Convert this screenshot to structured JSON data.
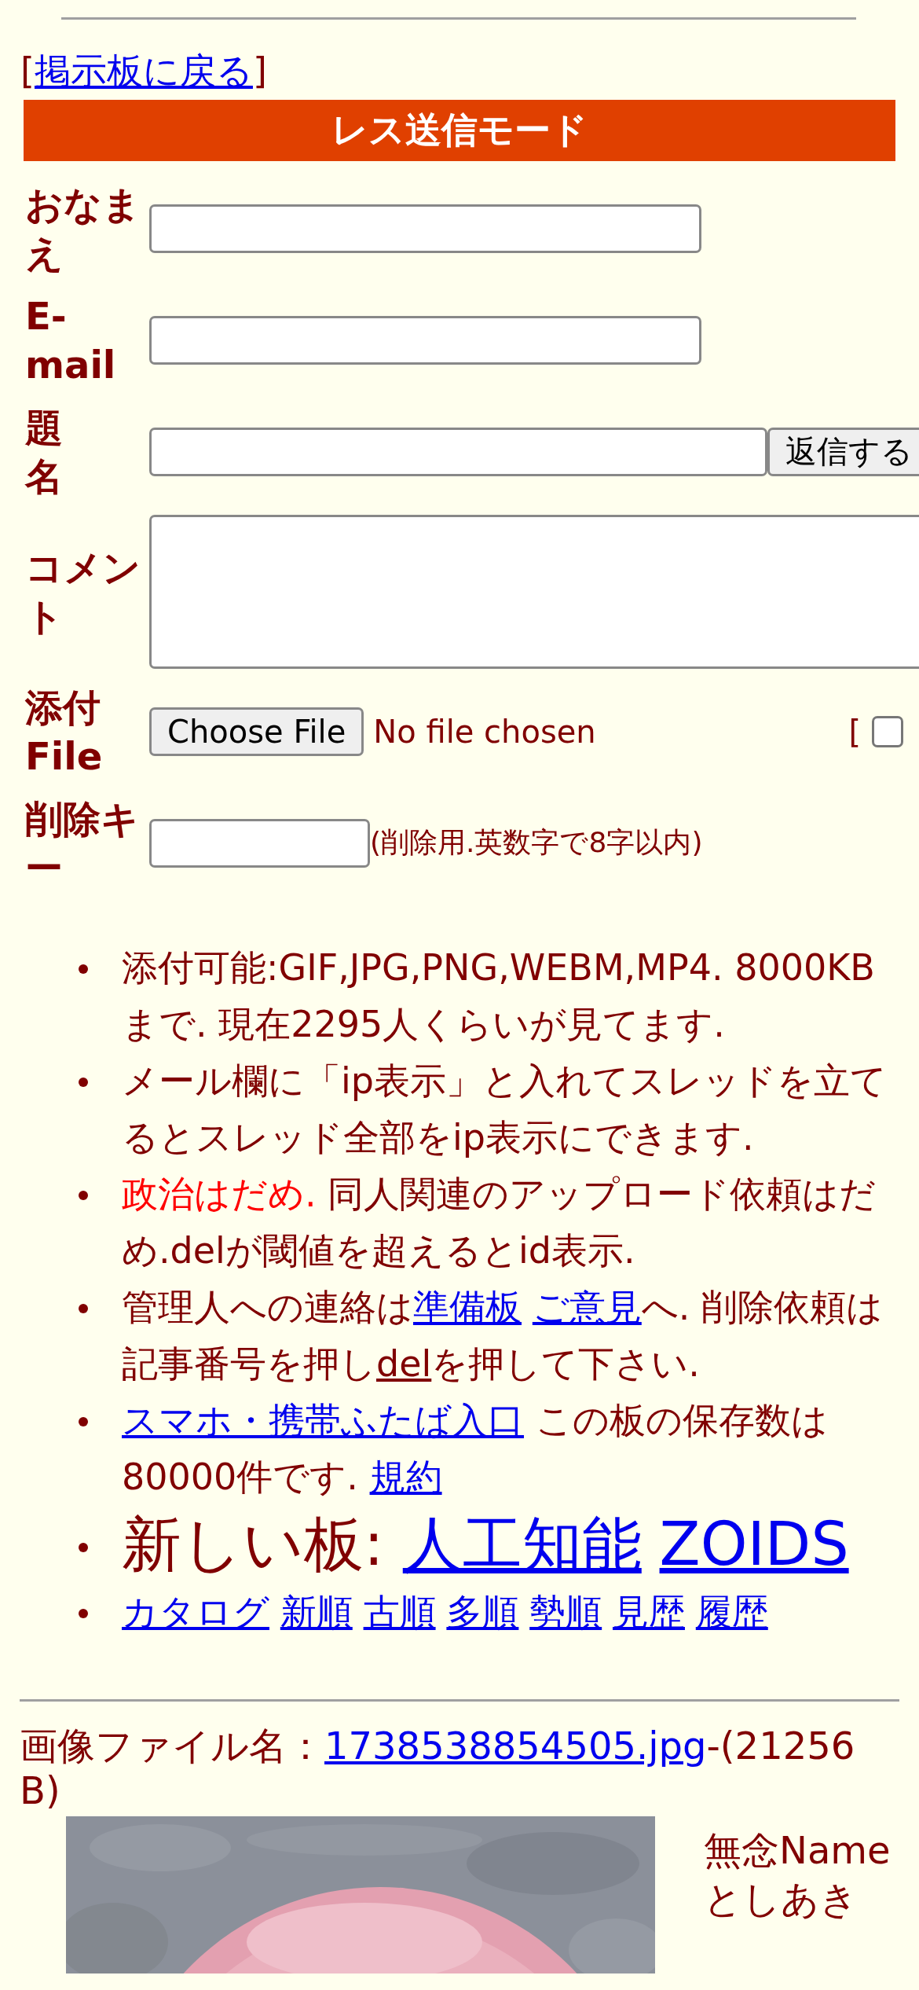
{
  "back_link": {
    "open": "[",
    "label": "掲示板に戻る",
    "close": "]"
  },
  "form": {
    "title": "レス送信モード",
    "rows": [
      {
        "kind": "text",
        "label": "おなまえ"
      },
      {
        "kind": "text",
        "label": "E-mail"
      },
      {
        "kind": "text_button",
        "label": "題名",
        "button": "返信する"
      },
      {
        "kind": "textarea",
        "label": "コメント"
      },
      {
        "kind": "file",
        "label": "添付File",
        "button": "Choose File",
        "status": "No file chosen",
        "bracket": "[",
        "checked": false
      },
      {
        "kind": "key",
        "label": "削除キー",
        "note": "(削除用.英数字で8字以内)"
      }
    ]
  },
  "notices": [
    {
      "kind": "normal",
      "parts": [
        {
          "kind": "text",
          "text": "添付可能:GIF,JPG,PNG,WEBM,MP4. 8000KBまで. 現在2295人くらいが見てます."
        }
      ]
    },
    {
      "kind": "normal",
      "parts": [
        {
          "kind": "text",
          "text": "メール欄に「ip表示」と入れてスレッドを立てるとスレッド全部をip表示にできます."
        }
      ]
    },
    {
      "kind": "normal",
      "parts": [
        {
          "kind": "warning",
          "text": "政治はだめ."
        },
        {
          "kind": "text",
          "text": " 同人関連のアップロード依頼はだめ.delが閾値を超えるとid表示."
        }
      ]
    },
    {
      "kind": "normal",
      "parts": [
        {
          "kind": "text",
          "text": "管理人への連絡は"
        },
        {
          "kind": "link",
          "text": "準備板"
        },
        {
          "kind": "link",
          "text": "ご意見"
        },
        {
          "kind": "text",
          "text": "へ. 削除依頼は記事番号を押し"
        },
        {
          "kind": "plain_link",
          "text": "del"
        },
        {
          "kind": "text",
          "text": "を押して下さい."
        }
      ]
    },
    {
      "kind": "normal",
      "parts": [
        {
          "kind": "link",
          "text": "スマホ・携帯ふたば入口"
        },
        {
          "kind": "text",
          "text": " この板の保存数は80000件です. "
        },
        {
          "kind": "link",
          "text": "規約"
        }
      ]
    },
    {
      "kind": "large",
      "parts": [
        {
          "kind": "text",
          "text": "新しい板: "
        },
        {
          "kind": "link",
          "text": "人工知能"
        },
        {
          "kind": "link",
          "text": "ZOIDS"
        }
      ]
    },
    {
      "kind": "normal",
      "parts": [
        {
          "kind": "link",
          "text": "カタログ"
        },
        {
          "kind": "link",
          "text": "新順"
        },
        {
          "kind": "link",
          "text": "古順"
        },
        {
          "kind": "link",
          "text": "多順"
        },
        {
          "kind": "link",
          "text": "勢順"
        },
        {
          "kind": "link",
          "text": "見歴"
        },
        {
          "kind": "link",
          "text": "履歴"
        }
      ]
    }
  ],
  "file_info": {
    "label": "画像ファイル名：",
    "link": "1738538854505.jpg",
    "size": "-(21256 B)"
  },
  "post": {
    "name": "無念Name",
    "poster": "としあき"
  }
}
